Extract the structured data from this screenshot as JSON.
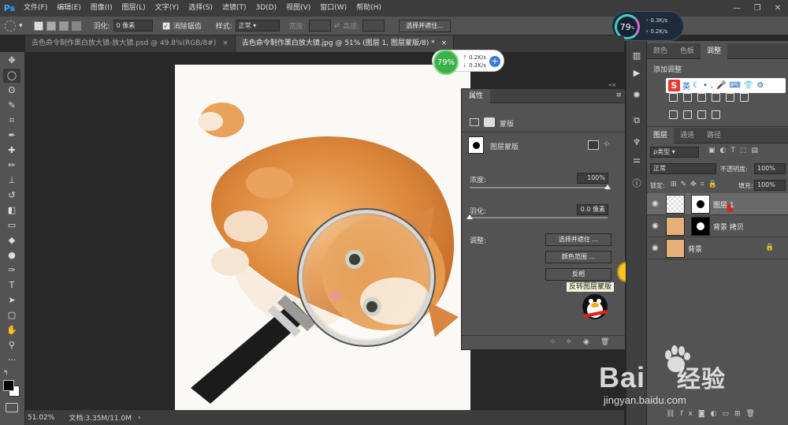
{
  "app": {
    "logo": "Ps"
  },
  "menu": [
    "文件(F)",
    "编辑(E)",
    "图像(I)",
    "图层(L)",
    "文字(Y)",
    "选择(S)",
    "滤镜(T)",
    "3D(D)",
    "视图(V)",
    "窗口(W)",
    "帮助(H)"
  ],
  "window_controls": {
    "minimize": "—",
    "restore": "❐",
    "close": "✕"
  },
  "options": {
    "feather_label": "羽化:",
    "feather_value": "0 像素",
    "antialias_label": "消除锯齿",
    "style_label": "样式:",
    "style_value": "正常",
    "width_label": "宽度:",
    "height_label": "高度:",
    "select_mask_button": "选择并遮住..."
  },
  "perf_widget": {
    "percent": "79",
    "unit": "%",
    "up": "0.3K/s",
    "down": "0.2K/s"
  },
  "perf_widget_small": {
    "percent": "79%",
    "up": "0.2K/s",
    "down": "0.2K/s",
    "plus": "+"
  },
  "tabs": [
    {
      "label": "去色命令制作黑白放大镜-放大镜.psd @ 49.8%(RGB/8#)",
      "close": "×",
      "active": false
    },
    {
      "label": "去色命令制作黑白放大镜.jpg @ 51% (图层 1, 图层蒙版/8) *",
      "close": "×",
      "active": true
    }
  ],
  "status": {
    "zoom": "51.02%",
    "doc": "文档:3.35M/11.0M",
    "arrow": "›"
  },
  "properties": {
    "tab": "属性",
    "mask_type": "蒙版",
    "layer_mask_label": "图层蒙版",
    "density_label": "浓度:",
    "density_value": "100%",
    "density_level": 1.0,
    "feather_label": "羽化:",
    "feather_value": "0.0 像素",
    "feather_level": 0.0,
    "adjust_label": "调整:",
    "select_mask_button": "选择并遮住 ...",
    "color_range_button": "颜色范围 ...",
    "invert_button": "反相"
  },
  "tooltip": "反转图层蒙版",
  "right_panel": {
    "top_tabs": [
      "颜色",
      "色板",
      "调整"
    ],
    "add_adjustment": "添加调整",
    "layer_tabs": [
      "图层",
      "通道",
      "路径"
    ],
    "kind_filter": "ρ类型",
    "blend_mode": "正常",
    "opacity_label": "不透明度:",
    "opacity_value": "100%",
    "lock_label": "锁定:",
    "fill_label": "填充:",
    "fill_value": "100%",
    "layers": [
      {
        "name": "图层 1",
        "selected": true
      },
      {
        "name": "背景 拷贝",
        "selected": false
      },
      {
        "name": "背景",
        "selected": false,
        "locked": true
      }
    ]
  },
  "sogou": {
    "logo": "S",
    "mode": "英"
  },
  "watermark": {
    "brand": "Bai",
    "brand2": "经验",
    "url": "jingyan.baidu.com"
  },
  "colors": {
    "accent": "#31a8ff",
    "panel": "#535353",
    "bg": "#282828",
    "red_arrow": "#e02020"
  }
}
